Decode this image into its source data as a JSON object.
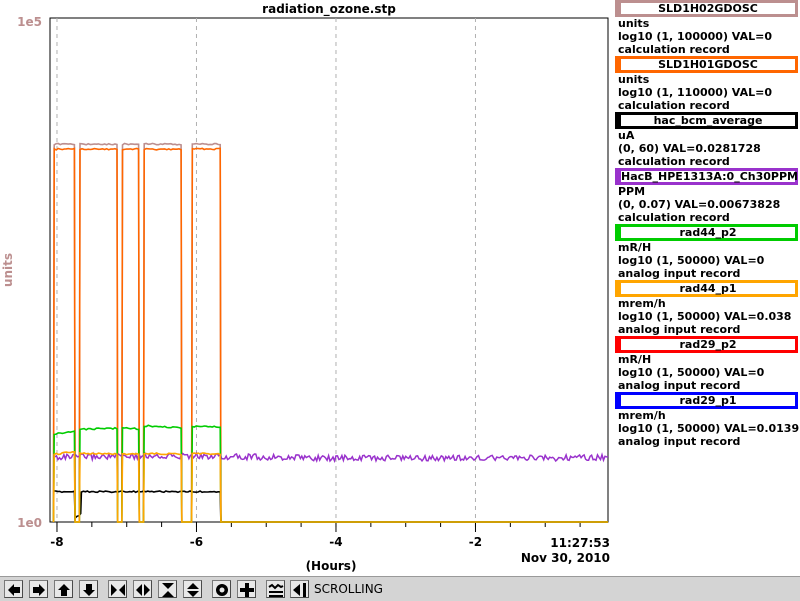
{
  "title": "radiation_ozone.stp",
  "chart_data": {
    "type": "line",
    "x_unit": "(Hours)",
    "x_ticks": [
      "-8",
      "-6",
      "-4",
      "-2"
    ],
    "xlim": [
      -8.1,
      -0.1
    ],
    "y_label": "units",
    "y_scale": "log",
    "ylim": [
      1,
      100000
    ],
    "y_tick_top": "1e5",
    "y_tick_bottom": "1e0",
    "grid": true,
    "series": [
      {
        "name": "SLD1H02GDOSC",
        "color": "#bc8f8f",
        "values": [
          [
            -8.05,
            1
          ],
          [
            -8.04,
            5600
          ],
          [
            -7.75,
            5600
          ],
          [
            -7.74,
            1
          ],
          [
            -7.68,
            1
          ],
          [
            -7.67,
            5600
          ],
          [
            -7.14,
            5600
          ],
          [
            -7.13,
            1
          ],
          [
            -7.07,
            1
          ],
          [
            -7.06,
            5600
          ],
          [
            -6.83,
            5600
          ],
          [
            -6.82,
            1
          ],
          [
            -6.76,
            1
          ],
          [
            -6.75,
            5600
          ],
          [
            -6.22,
            5600
          ],
          [
            -6.21,
            1
          ],
          [
            -6.07,
            1
          ],
          [
            -6.06,
            5600
          ],
          [
            -5.66,
            5600
          ],
          [
            -5.65,
            1
          ],
          [
            -0.1,
            1
          ]
        ]
      },
      {
        "name": "SLD1H01GDOSC",
        "color": "#ff6600",
        "values": [
          [
            -8.05,
            1
          ],
          [
            -8.04,
            5000
          ],
          [
            -7.75,
            5000
          ],
          [
            -7.74,
            1
          ],
          [
            -7.68,
            1
          ],
          [
            -7.67,
            5000
          ],
          [
            -7.14,
            5000
          ],
          [
            -7.13,
            1
          ],
          [
            -7.07,
            1
          ],
          [
            -7.06,
            5000
          ],
          [
            -6.83,
            5000
          ],
          [
            -6.82,
            1
          ],
          [
            -6.76,
            1
          ],
          [
            -6.75,
            5000
          ],
          [
            -6.22,
            5000
          ],
          [
            -6.21,
            1
          ],
          [
            -6.07,
            1
          ],
          [
            -6.06,
            5000
          ],
          [
            -5.66,
            5000
          ],
          [
            -5.65,
            1
          ],
          [
            -0.1,
            1
          ]
        ]
      },
      {
        "name": "hac_bcm_average",
        "color": "#000000",
        "values": [
          [
            -8.05,
            2.0
          ],
          [
            -7.75,
            2.0
          ],
          [
            -7.74,
            1.1
          ],
          [
            -7.66,
            1.2
          ],
          [
            -7.65,
            2.0
          ],
          [
            -5.66,
            2.0
          ],
          [
            -5.65,
            1
          ],
          [
            -0.1,
            1
          ]
        ]
      },
      {
        "name": "HacB_HPE1313A:0_Ch30PPM",
        "color": "#9932cc",
        "values": [
          [
            -8.05,
            4.4
          ],
          [
            -7.0,
            4.5
          ],
          [
            -6.0,
            4.5
          ],
          [
            -5.0,
            4.4
          ],
          [
            -4.0,
            4.3
          ],
          [
            -3.0,
            4.3
          ],
          [
            -2.0,
            4.3
          ],
          [
            -1.0,
            4.3
          ],
          [
            -0.1,
            4.4
          ]
        ]
      },
      {
        "name": "rad44_p2",
        "color": "#00cc00",
        "values": [
          [
            -8.05,
            1
          ],
          [
            -8.04,
            7.5
          ],
          [
            -7.75,
            8.0
          ],
          [
            -7.74,
            1
          ],
          [
            -7.68,
            1
          ],
          [
            -7.67,
            8.3
          ],
          [
            -7.14,
            8.5
          ],
          [
            -7.13,
            1
          ],
          [
            -7.07,
            1
          ],
          [
            -7.06,
            8.5
          ],
          [
            -6.83,
            8.4
          ],
          [
            -6.82,
            1
          ],
          [
            -6.76,
            1
          ],
          [
            -6.75,
            9.0
          ],
          [
            -6.22,
            8.6
          ],
          [
            -6.21,
            1
          ],
          [
            -6.07,
            1
          ],
          [
            -6.06,
            8.9
          ],
          [
            -5.66,
            8.8
          ],
          [
            -5.65,
            1
          ],
          [
            -0.1,
            1
          ]
        ]
      },
      {
        "name": "rad44_p1",
        "color": "#ffa500",
        "values": [
          [
            -8.05,
            1
          ],
          [
            -8.04,
            4.7
          ],
          [
            -7.75,
            5.0
          ],
          [
            -7.74,
            1
          ],
          [
            -7.68,
            1
          ],
          [
            -7.67,
            4.8
          ],
          [
            -7.14,
            4.7
          ],
          [
            -7.13,
            1
          ],
          [
            -7.07,
            1
          ],
          [
            -7.06,
            4.7
          ],
          [
            -6.83,
            4.7
          ],
          [
            -6.82,
            1
          ],
          [
            -6.76,
            1
          ],
          [
            -6.75,
            4.8
          ],
          [
            -6.22,
            4.7
          ],
          [
            -6.21,
            1
          ],
          [
            -6.07,
            1
          ],
          [
            -6.06,
            4.8
          ],
          [
            -5.66,
            4.7
          ],
          [
            -5.65,
            1
          ],
          [
            -0.1,
            1
          ]
        ]
      },
      {
        "name": "rad29_p2",
        "color": "#ff0000",
        "values": []
      },
      {
        "name": "rad29_p1",
        "color": "#0000ff",
        "values": []
      }
    ]
  },
  "legend": [
    {
      "name": "SLD1H02GDOSC",
      "color": "#bc8f8f",
      "unit": "units",
      "range": "log10 (1, 100000) VAL=0",
      "record": "calculation record"
    },
    {
      "name": "SLD1H01GDOSC",
      "color": "#ff6600",
      "unit": "units",
      "range": "log10 (1, 110000) VAL=0",
      "record": "calculation record"
    },
    {
      "name": "hac_bcm_average",
      "color": "#000000",
      "unit": "uA",
      "range": "(0, 60) VAL=0.0281728",
      "record": "calculation record"
    },
    {
      "name": "HacB_HPE1313A:0_Ch30PPM",
      "color": "#9932cc",
      "unit": "PPM",
      "range": "(0, 0.07) VAL=0.00673828",
      "record": "calculation record"
    },
    {
      "name": "rad44_p2",
      "color": "#00cc00",
      "unit": "mR/H",
      "range": "log10 (1, 50000) VAL=0",
      "record": "analog input record"
    },
    {
      "name": "rad44_p1",
      "color": "#ffa500",
      "unit": "mrem/h",
      "range": "log10 (1, 50000) VAL=0.038",
      "record": "analog input record"
    },
    {
      "name": "rad29_p2",
      "color": "#ff0000",
      "unit": "mR/H",
      "range": "log10 (1, 50000) VAL=0",
      "record": "analog input record"
    },
    {
      "name": "rad29_p1",
      "color": "#0000ff",
      "unit": "mrem/h",
      "range": "log10 (1, 50000) VAL=0.0139",
      "record": "analog input record"
    }
  ],
  "timestamp": {
    "time": "11:27:53",
    "date": "Nov 30, 2010"
  },
  "toolbar": {
    "buttons": [
      "pan-left-icon",
      "pan-right-icon",
      "pan-up-icon",
      "pan-down-icon",
      "zoom-x-in-icon",
      "zoom-x-out-icon",
      "zoom-y-in-icon",
      "zoom-y-out-icon",
      "autoscale-icon",
      "zoom-default-icon",
      "scroll-mode-icon",
      "return-icon"
    ],
    "mode": "SCROLLING"
  }
}
